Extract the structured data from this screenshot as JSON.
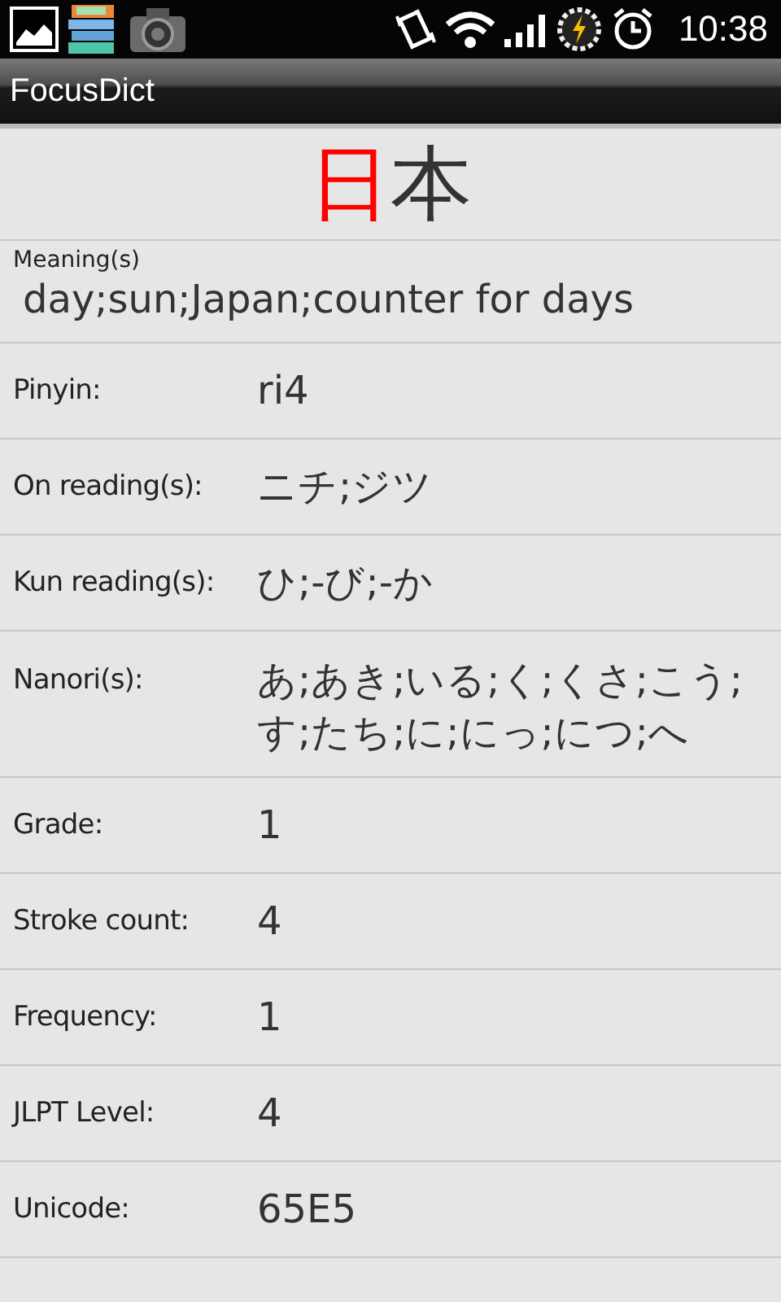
{
  "status_bar": {
    "time": "10:38"
  },
  "app_bar": {
    "title": "FocusDict"
  },
  "kanji": [
    {
      "char": "日",
      "highlighted": true
    },
    {
      "char": "本",
      "highlighted": false
    }
  ],
  "meaning": {
    "label": "Meaning(s)",
    "value": "day;sun;Japan;counter for days"
  },
  "rows": [
    {
      "label": "Pinyin:",
      "value": "ri4"
    },
    {
      "label": "On reading(s):",
      "value": "ニチ;ジツ"
    },
    {
      "label": "Kun reading(s):",
      "value": "ひ;-び;-か"
    },
    {
      "label": "Nanori(s):",
      "value": "あ;あき;いる;く;くさ;こう;す;たち;に;にっ;につ;へ"
    },
    {
      "label": "Grade:",
      "value": "1"
    },
    {
      "label": "Stroke count:",
      "value": "4"
    },
    {
      "label": "Frequency:",
      "value": "1"
    },
    {
      "label": "JLPT Level:",
      "value": "4"
    },
    {
      "label": "Unicode:",
      "value": "65E5"
    }
  ]
}
